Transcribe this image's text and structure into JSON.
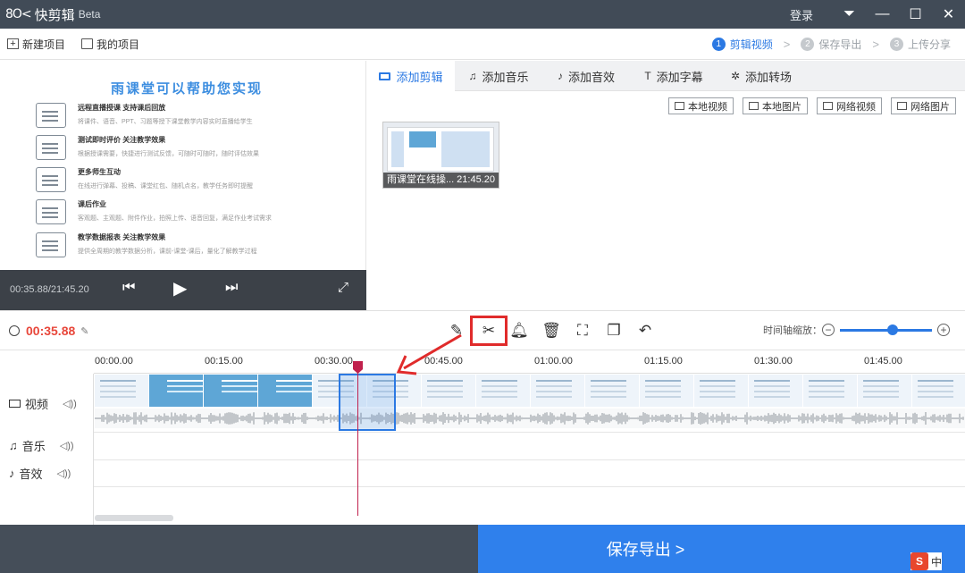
{
  "app": {
    "name": "快剪辑",
    "badge": "Beta"
  },
  "window": {
    "login": "登录"
  },
  "menu": {
    "new_project": "新建项目",
    "my_projects": "我的项目"
  },
  "steps": [
    {
      "num": "1",
      "label": "剪辑视频",
      "active": true
    },
    {
      "num": "2",
      "label": "保存导出",
      "active": false
    },
    {
      "num": "3",
      "label": "上传分享",
      "active": false
    }
  ],
  "preview": {
    "title": "雨课堂可以帮助您实现",
    "features": [
      {
        "heading": "远程直播授课 支持课后回放",
        "desc": "将课件、语音、PPT、习题等授下课堂教学内容实时直播给学生"
      },
      {
        "heading": "测试即时评价 关注教学效果",
        "desc": "根据授课需要，快捷进行测试反馈，可随时可随时，随时评估效果"
      },
      {
        "heading": "更多师生互动",
        "desc": "在线进行弹幕、投稿、课堂红包、随机点名，教学任务即时提醒"
      },
      {
        "heading": "课后作业",
        "desc": "客观题、主观题、附件作业，拍照上传、语音回复，满足作业考试需求"
      },
      {
        "heading": "教学数据报表 关注教学效果",
        "desc": "提供全周期的教学数据分析，课前-课堂-课后，量化了解教学过程"
      }
    ],
    "time": "00:35.88/21:45.20"
  },
  "tabs": [
    {
      "label": "添加剪辑",
      "icon": "video-icon",
      "active": true
    },
    {
      "label": "添加音乐",
      "icon": "music-icon",
      "active": false
    },
    {
      "label": "添加音效",
      "icon": "sound-effect-icon",
      "active": false
    },
    {
      "label": "添加字幕",
      "icon": "text-icon",
      "active": false
    },
    {
      "label": "添加转场",
      "icon": "transition-icon",
      "active": false
    }
  ],
  "sources": [
    "本地视频",
    "本地图片",
    "网络视频",
    "网络图片"
  ],
  "clip": {
    "name": "雨课堂在线操...",
    "duration": "21:45.20"
  },
  "toolbar": {
    "current_time": "00:35.88",
    "zoom_label": "时间轴缩放：",
    "zoom_level": 0.55
  },
  "timeline": {
    "ticks": [
      "00:00.00",
      "00:15.00",
      "00:30.00",
      "00:45.00",
      "01:00.00",
      "01:15.00",
      "01:30.00",
      "01:45.00"
    ],
    "tracks": [
      "视频",
      "音乐",
      "音效"
    ]
  },
  "bottom": {
    "save_export": "保存导出 >"
  },
  "ime": {
    "label": "中"
  },
  "colors": {
    "accent": "#2b79e3",
    "playhead": "#c0214d",
    "highlight": "#e02b2b",
    "titlebar": "#414b57"
  }
}
